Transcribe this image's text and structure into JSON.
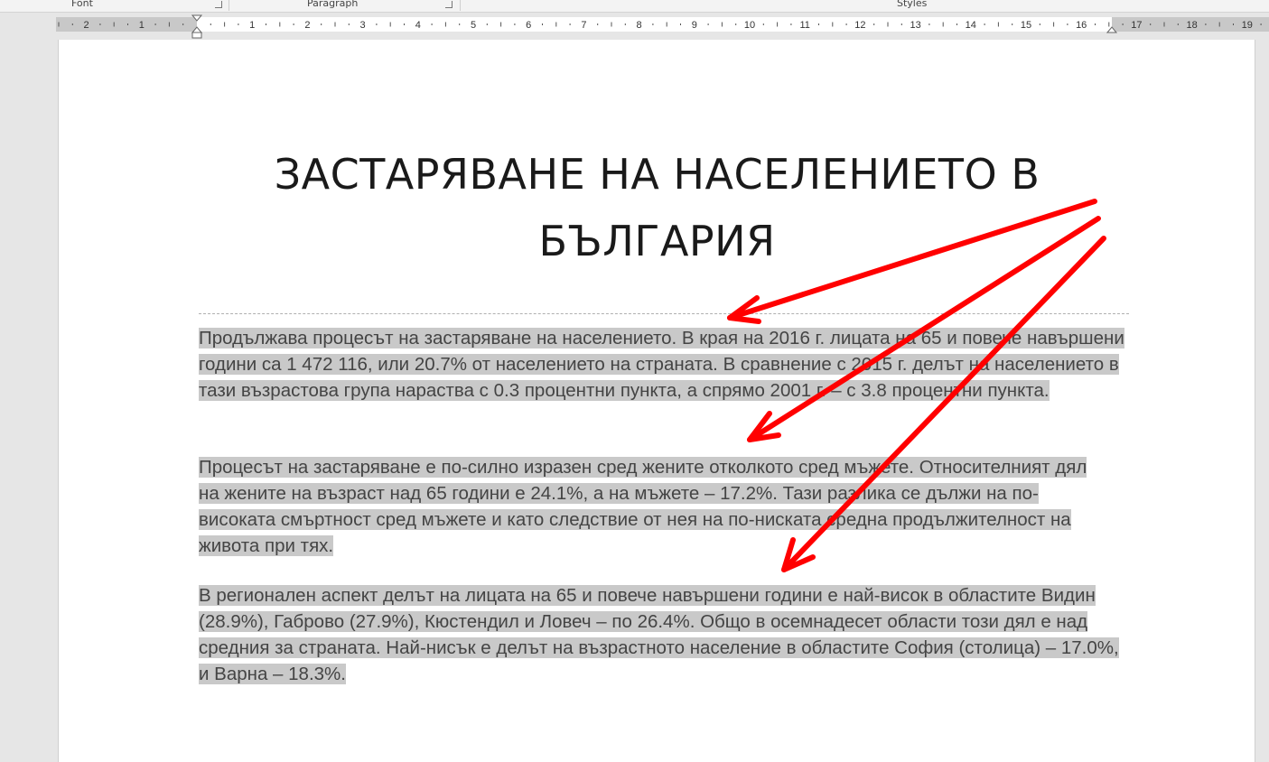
{
  "ribbon": {
    "groups": [
      {
        "label": "Font"
      },
      {
        "label": "Paragraph"
      },
      {
        "label": "Styles"
      }
    ]
  },
  "ruler": {
    "left_labels": [
      "2",
      "1"
    ],
    "right_labels": [
      "1",
      "2",
      "3",
      "4",
      "5",
      "6",
      "7",
      "8",
      "9",
      "10",
      "11",
      "12",
      "13",
      "14",
      "15",
      "16",
      "17",
      "18",
      "19"
    ]
  },
  "document": {
    "title_line1": "ЗАСТАРЯВАНЕ НА НАСЕЛЕНИЕТО В",
    "title_line2": "БЪЛГАРИЯ",
    "paragraphs": [
      "Продължава процесът на застаряване на населението. В края на 2016 г. лицата на 65 и повече навършени години са 1 472 116, или 20.7% от населението на страната. В сравнение с 2015 г. делът на населението в тази възрастова група нараства с 0.3 процентни пункта, а спрямо 2001 г. – с 3.8 процентни пункта.",
      "Процесът на застаряване е по-силно изразен сред жените отколкото сред мъжете. Относителният дял на жените на възраст над 65 години е 24.1%, а на мъжете – 17.2%. Тази разлика се дължи на по-високата смъртност сред мъжете и като следствие от нея на по-ниската средна продължителност на живота при тях.",
      "В регионален аспект делът на лицата на 65 и повече навършени години е най-висок в областите Видин (28.9%), Габрово (27.9%), Кюстендил и Ловеч – по 26.4%. Общо в осемнадесет области този дял е над средния за страната. Най-нисък е делът на възрастното население в областите София (столица) – 17.0%, и Варна – 18.3%."
    ],
    "selection_color": "#c9c9c9"
  },
  "annotations": {
    "arrow_color": "#ff0000"
  }
}
